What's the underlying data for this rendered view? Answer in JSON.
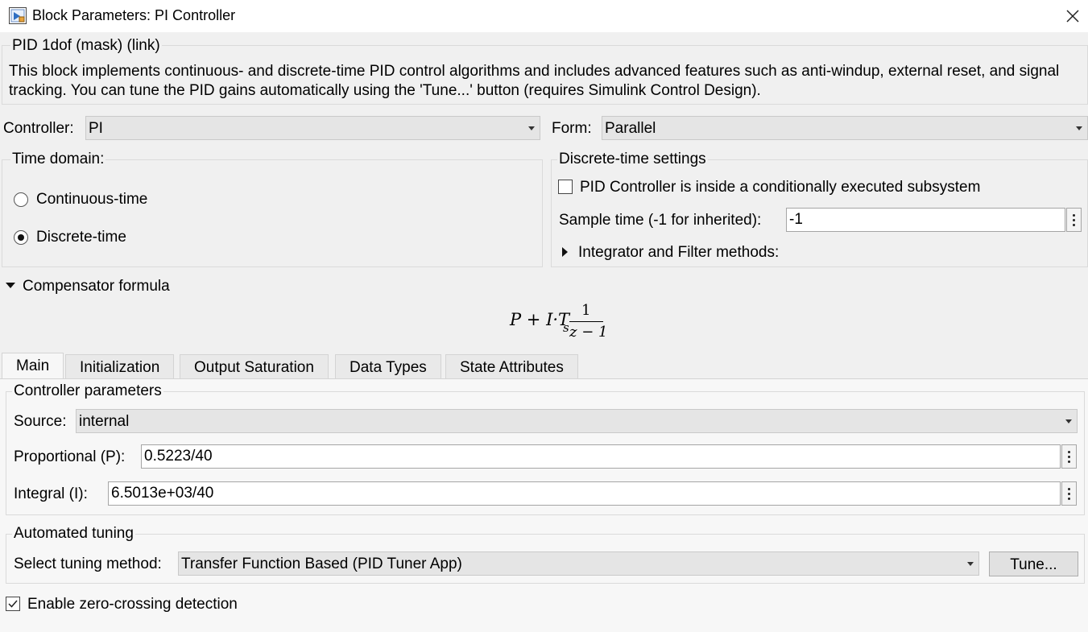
{
  "window": {
    "title": "Block Parameters: PI Controller",
    "icon": "simulink-block-icon",
    "close_icon": "close-icon"
  },
  "mask": {
    "header": "PID 1dof (mask) (link)",
    "description": "This block implements continuous- and discrete-time PID control algorithms and includes advanced features such as anti-windup, external reset, and signal tracking. You can tune the PID gains automatically using the 'Tune...' button (requires Simulink Control Design)."
  },
  "controller": {
    "label": "Controller:",
    "value": "PI"
  },
  "form": {
    "label": "Form:",
    "value": "Parallel"
  },
  "time_domain": {
    "title": "Time domain:",
    "options": [
      "Continuous-time",
      "Discrete-time"
    ],
    "selected": "Discrete-time"
  },
  "discrete_settings": {
    "title": "Discrete-time settings",
    "conditional_label": "PID Controller is inside a conditionally executed subsystem",
    "conditional_checked": false,
    "sample_time_label": "Sample time (-1 for inherited):",
    "sample_time_value": "-1",
    "integrator_methods_label": "Integrator and Filter methods:"
  },
  "compensator": {
    "label": "Compensator formula",
    "formula": {
      "terms": "P + I·T",
      "subscript": "s",
      "numerator": "1",
      "denominator": "z − 1"
    }
  },
  "tabs": [
    "Main",
    "Initialization",
    "Output Saturation",
    "Data Types",
    "State Attributes"
  ],
  "active_tab": "Main",
  "controller_parameters": {
    "title": "Controller parameters",
    "source_label": "Source:",
    "source_value": "internal",
    "proportional_label": "Proportional (P):",
    "proportional_value": "0.5223/40",
    "integral_label": "Integral (I):",
    "integral_value": "6.5013e+03/40"
  },
  "automated_tuning": {
    "title": "Automated tuning",
    "method_label": "Select tuning method:",
    "method_value": "Transfer Function Based (PID Tuner App)",
    "tune_button": "Tune..."
  },
  "zero_crossing": {
    "label": "Enable zero-crossing detection",
    "checked": true
  }
}
